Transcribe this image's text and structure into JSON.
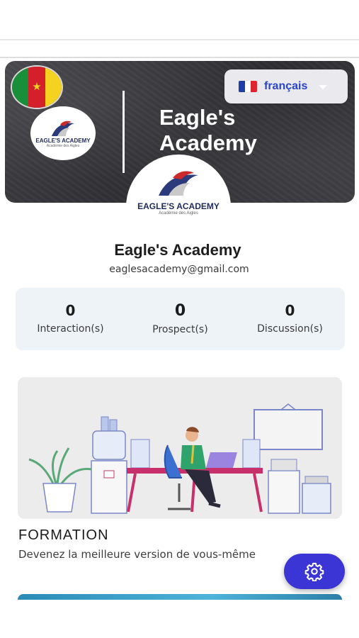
{
  "banner": {
    "language": {
      "label": "français",
      "flag_icon": "france-flag-icon"
    },
    "country_flag_icon": "cameroon-flag-icon",
    "title": "Eagle's Academy",
    "logo": {
      "text": "EAGLE'S ACADEMY",
      "subtext": "Académie des Aigles"
    }
  },
  "profile": {
    "name": "Eagle's Academy",
    "email": "eaglesacademy@gmail.com"
  },
  "stats": [
    {
      "value": "0",
      "label": "Interaction(s)"
    },
    {
      "value": "0",
      "label": "Prospect(s)"
    },
    {
      "value": "0",
      "label": "Discussion(s)"
    }
  ],
  "feature_card": {
    "title": "FORMATION",
    "subtitle": "Devenez la meilleure version de vous-même"
  },
  "fab": {
    "icon": "gear-icon"
  },
  "colors": {
    "accent": "#3b35d6",
    "language_text": "#2b44c8",
    "stats_bg": "#eef3f8"
  }
}
